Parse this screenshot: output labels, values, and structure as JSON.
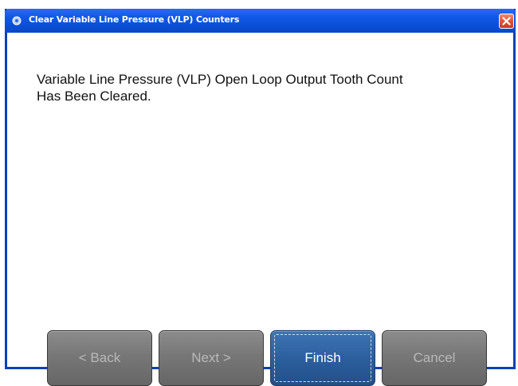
{
  "window": {
    "title": "Clear Variable Line Pressure (VLP) Counters"
  },
  "message": {
    "line1": "Variable Line Pressure (VLP) Open Loop Output Tooth Count",
    "line2": "Has Been Cleared."
  },
  "buttons": {
    "back_label": "< Back",
    "next_label": "Next >",
    "finish_label": "Finish",
    "cancel_label": "Cancel"
  },
  "icons": {
    "title": "gear-icon",
    "close": "close-icon"
  },
  "colors": {
    "titlebar": "#0b4fd6",
    "finish_button": "#2c5f9e",
    "disabled_button": "#777777",
    "close_button": "#e0543a"
  }
}
